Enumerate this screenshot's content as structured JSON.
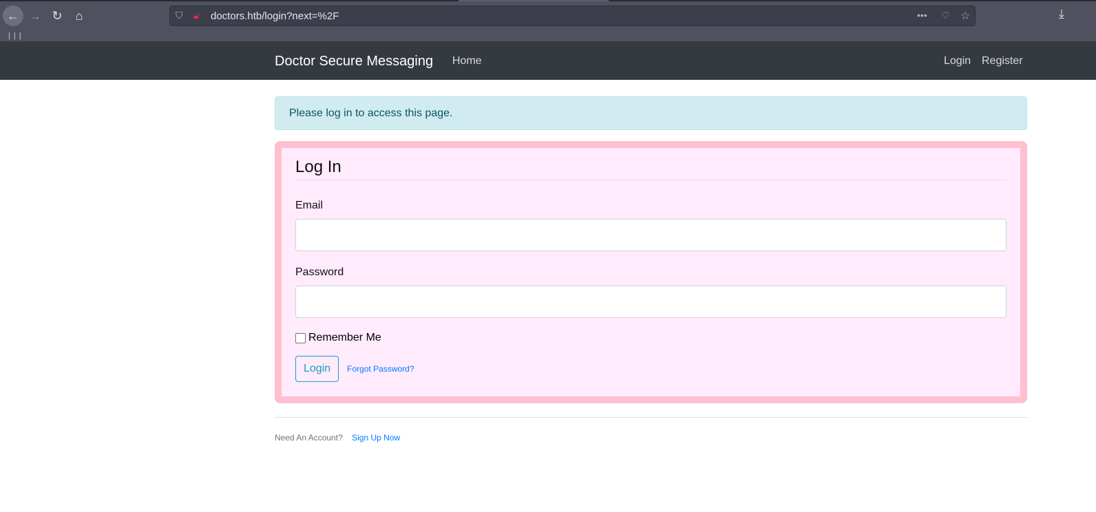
{
  "browser": {
    "url": "doctors.htb/login?next=%2F",
    "bookmarks": "|||"
  },
  "navbar": {
    "brand": "Doctor Secure Messaging",
    "home": "Home",
    "login": "Login",
    "register": "Register"
  },
  "alert": "Please log in to access this page.",
  "form": {
    "title": "Log In",
    "email_label": "Email",
    "email_value": "",
    "password_label": "Password",
    "password_value": "",
    "remember_label": "Remember Me",
    "submit": "Login",
    "forgot": "Forgot Password?"
  },
  "footer": {
    "text": "Need An Account?",
    "link": "Sign Up Now"
  }
}
